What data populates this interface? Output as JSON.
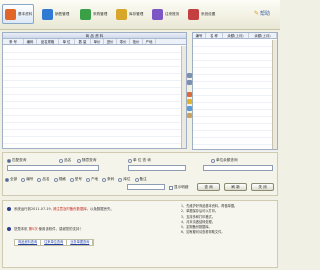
{
  "toolbar": {
    "buttons": [
      {
        "label": "基本资料",
        "color": "#e0662a"
      },
      {
        "label": "销售管理",
        "color": "#2f7bd3"
      },
      {
        "label": "采购管理",
        "color": "#3aa048"
      },
      {
        "label": "库存管理",
        "color": "#d8a62a"
      },
      {
        "label": "往来账务",
        "color": "#7c56c4"
      },
      {
        "label": "系统设置",
        "color": "#c44040"
      }
    ],
    "help": "帮助"
  },
  "left_table": {
    "title": "商 品 资 料",
    "columns": [
      "条 号",
      "编码",
      "品名规格",
      "单 位",
      "数 量",
      "单价",
      "进价",
      "零价",
      "批价",
      "产地"
    ]
  },
  "right_table": {
    "columns": [
      "编号",
      "名 称",
      "余额(上月)",
      "余额(上月)"
    ]
  },
  "search": {
    "radios_top": [
      "匹配查询",
      "品名",
      "随意查询"
    ],
    "mid_label": "单 位 查 询",
    "right_label": "单位余额查询",
    "radios_bottom": [
      "全部",
      "编号",
      "品名",
      "规格",
      "型号",
      "产地",
      "条码",
      "库位",
      "备注"
    ],
    "checkbox": "显示明细",
    "buttons": {
      "query": "查 询",
      "prev": "刷 新",
      "exit": "关 闭"
    }
  },
  "info": {
    "line1_pre": "系统运行到2011-07-19, ",
    "line1_red": "请注意及时备份数据库",
    "line1_post": "，以免数据丢失。",
    "line2_pre": "您是本机 ",
    "line2_red": "第5次",
    "line2_post": " 使用该软件，感谢您的支持！",
    "tabs": [
      "商品资料查询",
      "往来单位查询",
      "业务单据查询"
    ],
    "tips": [
      "1、先维护好商品基本资料，再做单据。",
      "2、单据保存后可以打印。",
      "3、支持多种打印格式。",
      "4、月末请做结转处理。",
      "5、定期备份数据库。",
      "6、如有疑问请查看帮助文件。"
    ]
  }
}
